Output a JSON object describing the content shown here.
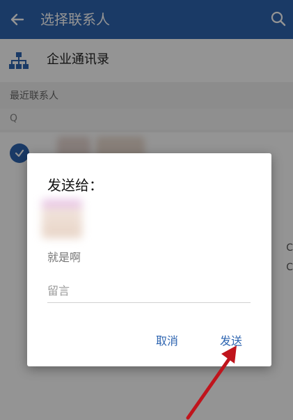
{
  "header": {
    "title": "选择联系人",
    "back_icon": "arrow-left-icon",
    "search_icon": "search-icon"
  },
  "org": {
    "icon": "org-chart-icon",
    "label": "企业通讯录"
  },
  "recent": {
    "label": "最近联系人",
    "search_hint": "Q"
  },
  "side_letters": [
    "C",
    "C"
  ],
  "dialog": {
    "title": "发送给：",
    "message_preview": "就是啊",
    "remark_placeholder": "留言",
    "cancel_label": "取消",
    "send_label": "发送"
  },
  "colors": {
    "primary": "#2d64b0",
    "annotation_arrow": "#c0141c"
  }
}
